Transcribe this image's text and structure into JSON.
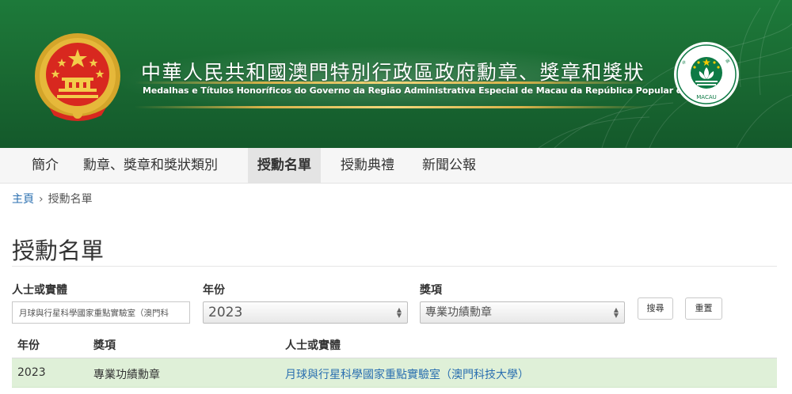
{
  "header": {
    "title_zh": "中華人民共和國澳門特別行政區政府勳章、獎章和獎狀",
    "title_pt": "Medalhas e Títulos Honoríficos do Governo da Região Administrativa Especial de Macau da República Popular da China",
    "macau_emblem_text": "MACAU"
  },
  "nav": {
    "items": [
      {
        "label": "簡介"
      },
      {
        "label": "勳章、獎章和獎狀類別"
      },
      {
        "label": "授勳名單"
      },
      {
        "label": "授勳典禮"
      },
      {
        "label": "新聞公報"
      }
    ],
    "active": "授勳名單"
  },
  "breadcrumb": {
    "home": "主頁",
    "current": "授勳名單"
  },
  "page_title": "授勳名單",
  "filters": {
    "person_label": "人士或實體",
    "person_value": "月球與行星科學國家重點實驗室（澳門科",
    "year_label": "年份",
    "year_value": "2023",
    "award_label": "獎項",
    "award_value": "專業功績勳章",
    "search_button": "搜尋",
    "reset_button": "重置"
  },
  "table": {
    "columns": [
      "年份",
      "獎項",
      "人士或實體"
    ],
    "rows": [
      {
        "year": "2023",
        "award": "專業功績勳章",
        "entity": "月球與行星科學國家重點實驗室（澳門科技大學）"
      }
    ]
  },
  "colors": {
    "banner_green": "#1a6b33",
    "nav_bg": "#f6f6f6",
    "link_blue": "#2a6fb0",
    "row_highlight": "#dff0d8"
  }
}
